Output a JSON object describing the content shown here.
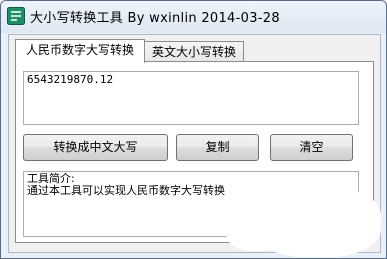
{
  "window": {
    "title": "大小写转换工具 By  wxinlin    2014-03-28"
  },
  "tabs": [
    {
      "label": "人民币数字大写转换",
      "active": true
    },
    {
      "label": "英文大小写转换",
      "active": false
    }
  ],
  "input": {
    "value": "6543219870.12"
  },
  "buttons": {
    "convert_label": "转换成中文大写",
    "copy_label": "复制",
    "clear_label": "清空"
  },
  "output": {
    "line1": "工具简介:",
    "line2": "通过本工具可以实现人民币数字大写转换"
  },
  "colors": {
    "titlebar": "#dde7f3",
    "window_bg": "#f0f0f0"
  },
  "icons": {
    "app_icon": "app-icon"
  }
}
